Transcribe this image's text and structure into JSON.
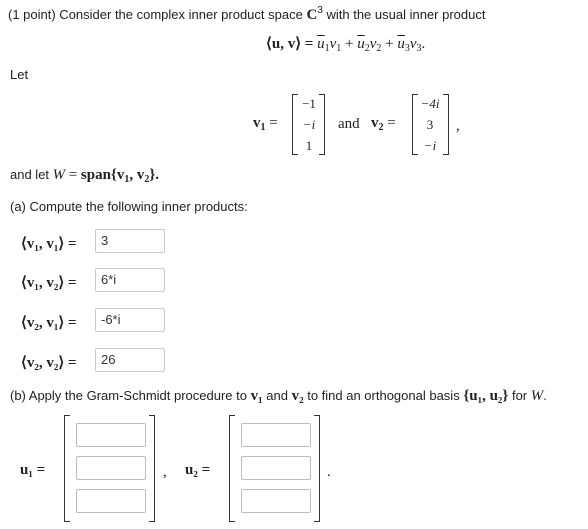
{
  "intro": {
    "prefix": "(1 point) Consider the complex inner product space",
    "space": "C",
    "space_exp": "3",
    "suffix": "with the usual inner product"
  },
  "inner_product": {
    "lhs": "⟨u, v⟩ =",
    "u1": "u",
    "v1": "v",
    "s1": "1",
    "u2": "u",
    "v2": "v",
    "s2": "2",
    "u3": "u",
    "v3": "v",
    "s3": "3",
    "plus": "+",
    "end": "."
  },
  "let_label": "Let",
  "vectors": {
    "v1_label": "v",
    "v1_sub": "1",
    "eq": "=",
    "v1_entries": [
      "−1",
      "−i",
      "1"
    ],
    "and": "and",
    "v2_label": "v",
    "v2_sub": "2",
    "v2_entries": [
      "−4i",
      "3",
      "−i"
    ],
    "comma": ","
  },
  "span_line": {
    "prefix": "and let",
    "W": "W",
    "eq": "=",
    "span": "span{v",
    "s1": "1",
    "mid": ", v",
    "s2": "2",
    "end": "}."
  },
  "part_a": {
    "prompt": "(a) Compute the following inner products:",
    "rows": [
      {
        "label": "⟨v₁, v₁⟩ =",
        "answer": "3"
      },
      {
        "label": "⟨v₁, v₂⟩ =",
        "answer": "6*i"
      },
      {
        "label": "⟨v₂, v₁⟩ =",
        "answer": "-6*i"
      },
      {
        "label": "⟨v₂, v₂⟩ =",
        "answer": "26"
      }
    ]
  },
  "part_b": {
    "prefix": "(b) Apply the Gram-Schmidt procedure to",
    "v1": "v₁",
    "and": "and",
    "v2": "v₂",
    "mid": "to find an orthogonal basis",
    "basis": "{u₁, u₂}",
    "for": "for",
    "W": "W",
    "end": "."
  },
  "basis_answer": {
    "u1_label": "u₁ =",
    "u2_label": "u₂ =",
    "comma": ",",
    "period": "."
  }
}
